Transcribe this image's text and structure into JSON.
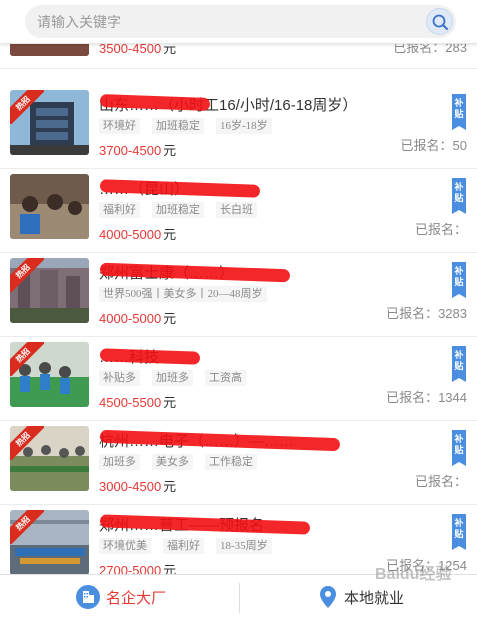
{
  "search": {
    "placeholder": "请输入关键字"
  },
  "items": [
    {
      "title": "",
      "tags": [],
      "salary": "3500-4500",
      "unit": "元",
      "signup_label": "已报名：",
      "signup_count": "283",
      "hot": false,
      "subsidy": false
    },
    {
      "title": "山东……（小时工16/小时/16-18周岁）",
      "tags": [
        "环境好",
        "加班稳定",
        "16岁-18岁"
      ],
      "salary": "3700-4500",
      "unit": "元",
      "signup_label": "已报名：",
      "signup_count": "50",
      "hot": true,
      "subsidy": true
    },
    {
      "title": "……（昆山）",
      "tags": [
        "福利好",
        "加班稳定",
        "长白班"
      ],
      "salary": "4000-5000",
      "unit": "元",
      "signup_label": "已报名：",
      "signup_count": "",
      "hot": false,
      "subsidy": true
    },
    {
      "title": "郑州富士康（……）",
      "tags": [
        "世界500强丨美女多丨20—48周岁"
      ],
      "salary": "4000-5000",
      "unit": "元",
      "signup_label": "已报名：",
      "signup_count": "3283",
      "hot": true,
      "subsidy": true
    },
    {
      "title": "……科技",
      "tags": [
        "补贴多",
        "加班多",
        "工资高"
      ],
      "salary": "4500-5500",
      "unit": "元",
      "signup_label": "已报名：",
      "signup_count": "1344",
      "hot": true,
      "subsidy": true
    },
    {
      "title": "杭州……电子（……）—……",
      "tags": [
        "加班多",
        "美女多",
        "工作稳定"
      ],
      "salary": "3000-4500",
      "unit": "元",
      "signup_label": "已报名：",
      "signup_count": "",
      "hot": true,
      "subsidy": true
    },
    {
      "title": "郑州……普工——预报名",
      "tags": [
        "环境优美",
        "福利好",
        "18-35周岁"
      ],
      "salary": "2700-5000",
      "unit": "元",
      "signup_label": "已报名：",
      "signup_count": "1254",
      "hot": true,
      "subsidy": true
    }
  ],
  "hot_label": "热招",
  "subsidy_label": "补贴",
  "bottom_nav": {
    "left_label": "名企大厂",
    "right_label": "本地就业"
  },
  "watermark": "Baidu经验",
  "colors": {
    "accent": "#4a8ee0",
    "salary": "#e53935",
    "hot": "#d92c1f"
  }
}
